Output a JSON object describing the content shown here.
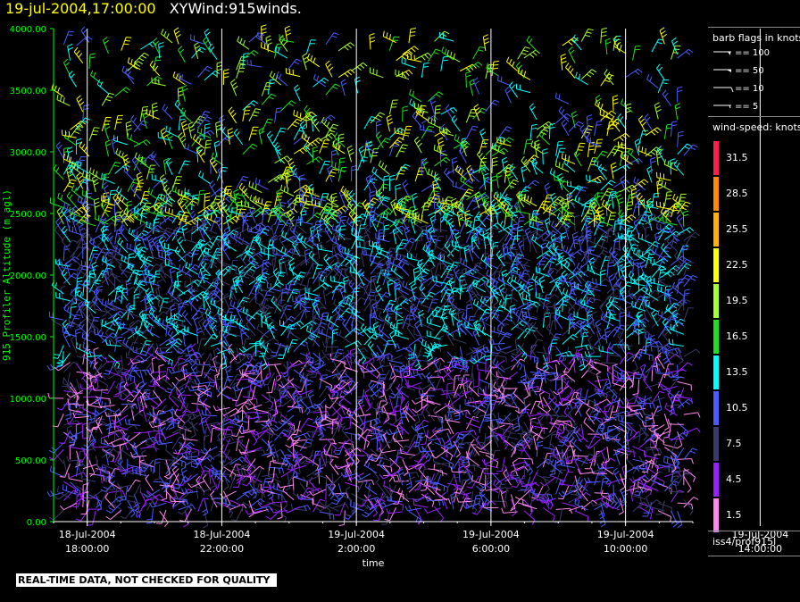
{
  "title": {
    "date": "19-jul-2004,17:00:00",
    "main": "XYWind:915winds."
  },
  "legend": {
    "flags_title": "barb flags in knots",
    "flags": [
      "== 100",
      "== 50",
      "== 10",
      "== 5"
    ],
    "speed_title": "wind-speed: knots",
    "source": "iss4/prof915l"
  },
  "quality_note": "REAL-TIME DATA, NOT CHECKED FOR QUALITY",
  "colors": {
    "background": "#000000",
    "axis": "#00ff00",
    "title_date": "#ffff00",
    "note_bg": "#ffffff",
    "vertical_lines": "#ffffff"
  },
  "chart_data": {
    "type": "wind-barb",
    "xlabel": "time",
    "ylabel": "915 Profiler Altitude (m agl)",
    "ylim": [
      0,
      4000
    ],
    "y_ticks": [
      "0.00",
      "500.00",
      "1000.00",
      "1500.00",
      "2000.00",
      "2500.00",
      "3000.00",
      "3500.00",
      "4000.00"
    ],
    "x_ticks": [
      {
        "date": "18-Jul-2004",
        "time": "18:00:00"
      },
      {
        "date": "18-Jul-2004",
        "time": "22:00:00"
      },
      {
        "date": "19-Jul-2004",
        "time": "2:00:00"
      },
      {
        "date": "19-Jul-2004",
        "time": "6:00:00"
      },
      {
        "date": "19-Jul-2004",
        "time": "10:00:00"
      },
      {
        "date": "19-Jul-2004",
        "time": "14:00:00"
      }
    ],
    "x_range_hours": [
      -1,
      18
    ],
    "speed_bins": [
      {
        "label": "31.5",
        "color": "#ff1f4f"
      },
      {
        "label": "28.5",
        "color": "#ff8c00"
      },
      {
        "label": "25.5",
        "color": "#ffb000"
      },
      {
        "label": "22.5",
        "color": "#ffff00"
      },
      {
        "label": "19.5",
        "color": "#a6ff2f"
      },
      {
        "label": "16.5",
        "color": "#1fdf1f"
      },
      {
        "label": "13.5",
        "color": "#00ffff"
      },
      {
        "label": "10.5",
        "color": "#4a5cff"
      },
      {
        "label": "7.5",
        "color": "#3a3a6a"
      },
      {
        "label": "4.5",
        "color": "#9a1fff"
      },
      {
        "label": "1.5",
        "color": "#ff88ee"
      }
    ]
  }
}
